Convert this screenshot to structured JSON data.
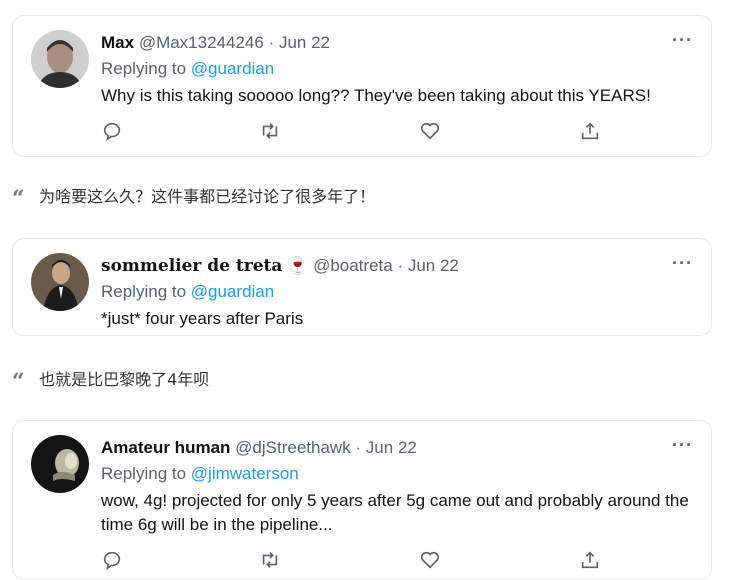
{
  "tweets": [
    {
      "name": "Max",
      "handle": "@Max13244246",
      "date": "· Jun 22",
      "replying_prefix": "Replying to",
      "replying_to": "@guardian",
      "text": "Why is this taking sooooo long?? They've been taking about this YEARS!"
    },
    {
      "name": "sommelier de treta",
      "emoji": "🍷",
      "handle": "@boatreta",
      "date": "· Jun 22",
      "replying_prefix": "Replying to",
      "replying_to": "@guardian",
      "text": "*just* four years after Paris"
    },
    {
      "name": "Amateur human",
      "handle": "@djStreethawk",
      "date": "· Jun 22",
      "replying_prefix": "Replying to",
      "replying_to": "@jimwaterson",
      "text": "wow, 4g! projected for only 5 years after 5g came out and probably around the time 6g will be in the pipeline..."
    }
  ],
  "translations": [
    "为啥要这么久？这件事都已经讨论了很多年了！",
    "也就是比巴黎晚了4年呗"
  ],
  "more_icon": "···",
  "icons": [
    "reply-icon",
    "retweet-icon",
    "like-icon",
    "share-icon"
  ],
  "colors": {
    "accent": "#1d9bf0",
    "secondary_text": "#536471",
    "border": "#e6e9ec"
  }
}
